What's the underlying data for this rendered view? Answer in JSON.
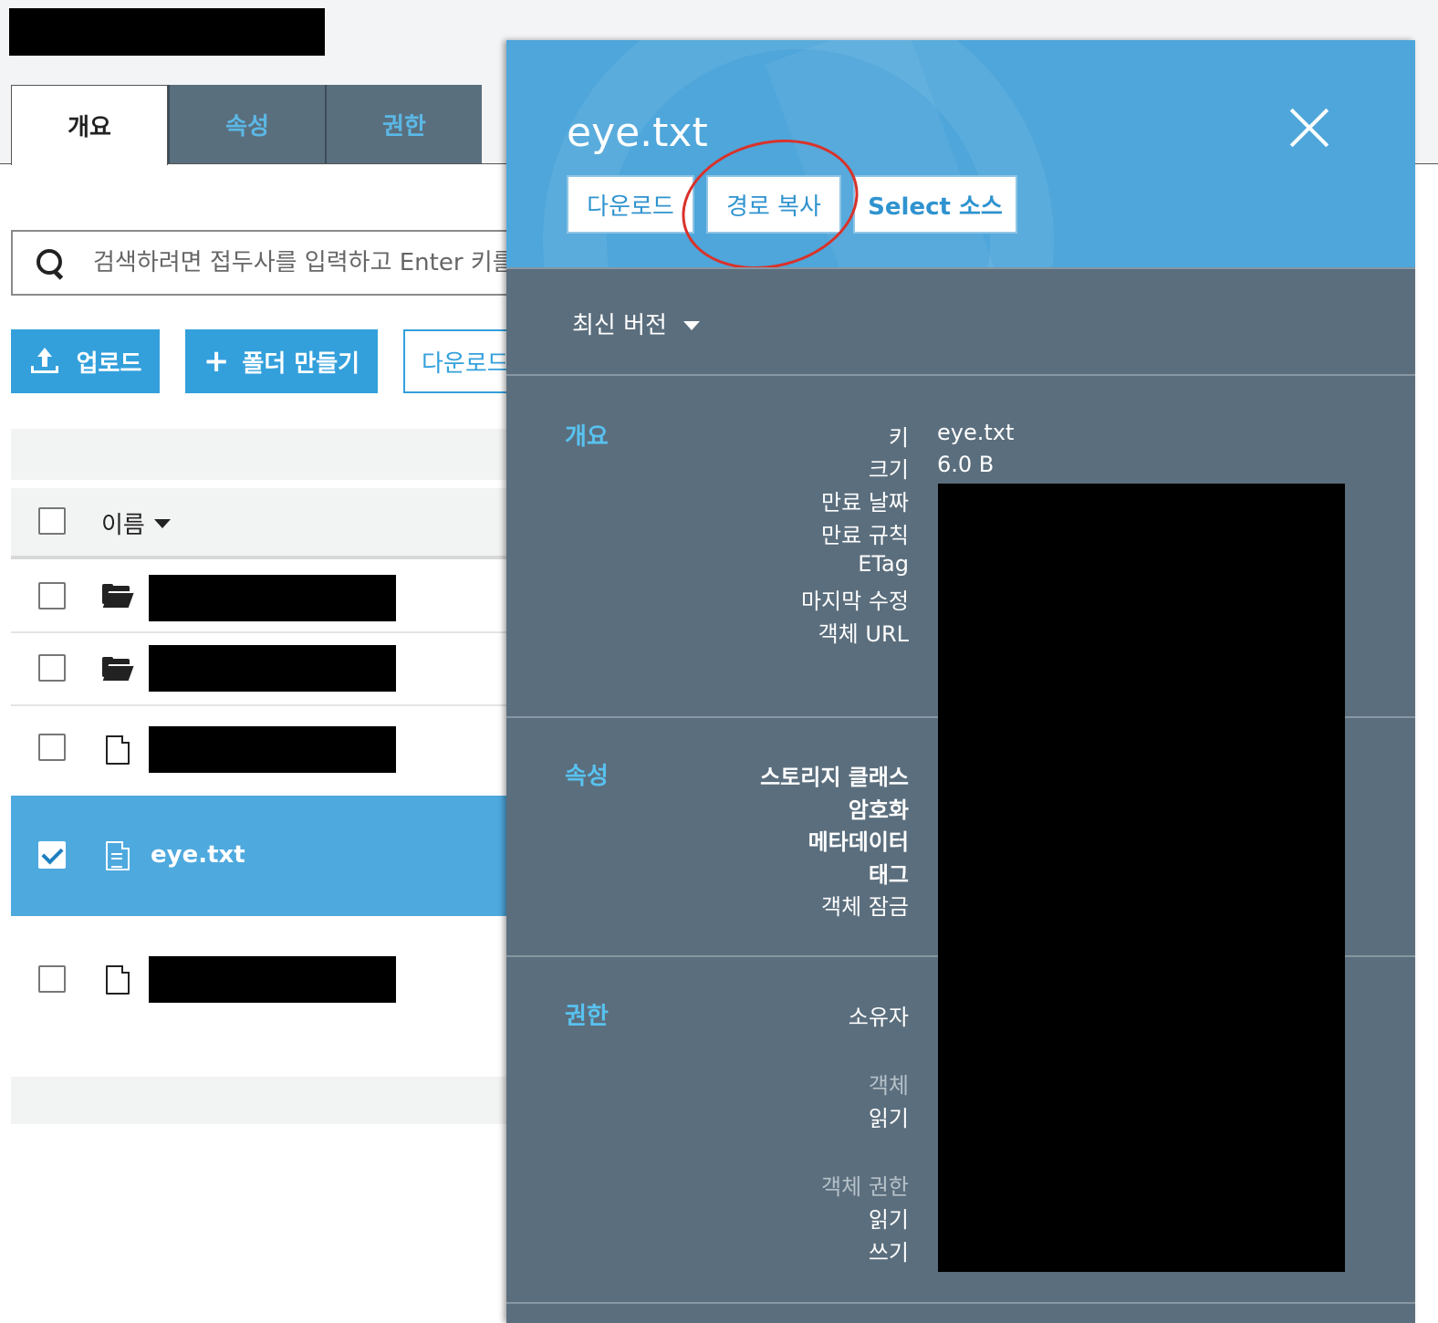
{
  "tabs": [
    {
      "label": "개요",
      "active": true
    },
    {
      "label": "속성",
      "active": false
    },
    {
      "label": "권한",
      "active": false
    }
  ],
  "search": {
    "placeholder": "검색하려면 접두사를 입력하고 Enter 키를"
  },
  "toolbar": {
    "upload_label": "업로드",
    "create_folder_label": "폴더 만들기",
    "download_label": "다운로드"
  },
  "list": {
    "name_header": "이름",
    "selected_file": "eye.txt"
  },
  "panel": {
    "title": "eye.txt",
    "download_label": "다운로드",
    "copy_path_label": "경로 복사",
    "select_source_label": "Select 소스",
    "version_label": "최신 버전",
    "overview": {
      "title": "개요",
      "labels": [
        "키",
        "크기",
        "만료 날짜",
        "만료 규칙",
        "ETag",
        "마지막 수정",
        "객체 URL"
      ],
      "key_value": "eye.txt",
      "size_value": "6.0 B"
    },
    "properties": {
      "title": "속성",
      "labels": [
        "스토리지 클래스",
        "암호화",
        "메타데이터",
        "태그",
        "객체 잠금"
      ]
    },
    "permissions": {
      "title": "권한",
      "owner_label": "소유자",
      "object_heading": "객체",
      "object_read": "읽기",
      "object_perm_heading": "객체 권한",
      "perm_read": "읽기",
      "perm_write": "쓰기"
    }
  },
  "colors": {
    "accent": "#33a0dc",
    "panel": "#5b6e7d",
    "panel_header": "#4ea6da",
    "annotation": "#d9322a"
  }
}
